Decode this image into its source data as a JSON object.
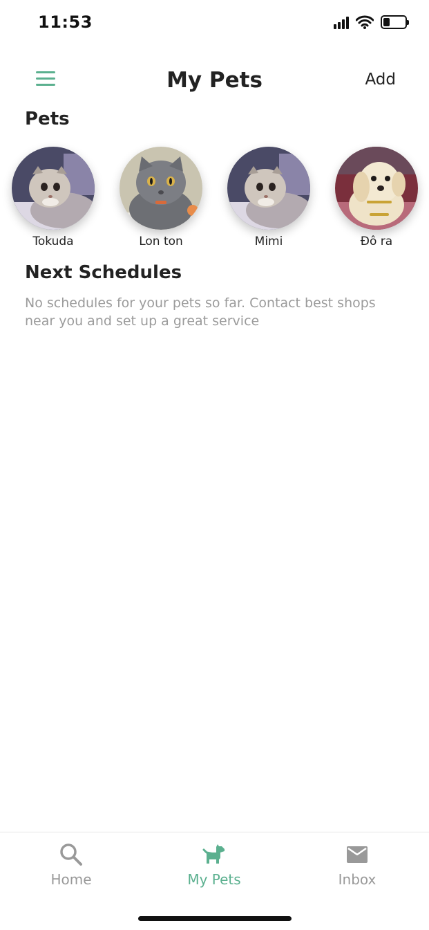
{
  "status_bar": {
    "time": "11:53",
    "battery_level": 0.3
  },
  "header": {
    "title": "My Pets",
    "add_label": "Add",
    "menu_icon": "hamburger-menu-icon"
  },
  "pets_section": {
    "title": "Pets",
    "pets": [
      {
        "name": "Tokuda",
        "photo": "grey-white-scottish-fold-cat"
      },
      {
        "name": "Lon ton",
        "photo": "grey-british-shorthair-cat"
      },
      {
        "name": "Mimi",
        "photo": "grey-white-scottish-fold-cat"
      },
      {
        "name": "Đô ra",
        "photo": "cream-puppy"
      }
    ]
  },
  "schedules": {
    "title": "Next Schedules",
    "empty_message": "No schedules for your pets so far. Contact best shops near you and set up a great service"
  },
  "bottom_nav": {
    "items": [
      {
        "label": "Home",
        "icon": "search-icon",
        "active": false
      },
      {
        "label": "My Pets",
        "icon": "dog-icon",
        "active": true
      },
      {
        "label": "Inbox",
        "icon": "mail-icon",
        "active": false
      }
    ]
  },
  "colors": {
    "accent": "#5bb08f",
    "inactive": "#999999",
    "muted_text": "#9b9b9b"
  }
}
